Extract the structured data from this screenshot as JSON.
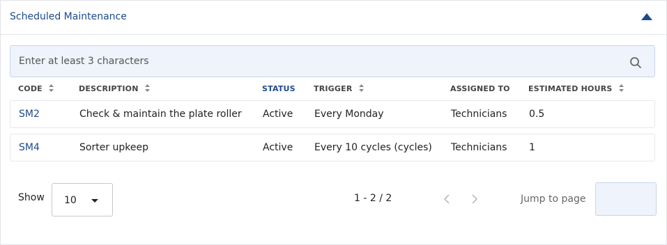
{
  "header": {
    "title": "Scheduled Maintenance"
  },
  "search": {
    "placeholder": "Enter at least 3 characters",
    "value": ""
  },
  "table": {
    "columns": {
      "code": "CODE",
      "description": "DESCRIPTION",
      "status": "STATUS",
      "trigger": "TRIGGER",
      "assigned_to": "ASSIGNED TO",
      "estimated_hours": "ESTIMATED HOURS"
    },
    "rows": [
      {
        "code": "SM2",
        "description": "Check & maintain the plate roller",
        "status": "Active",
        "trigger": "Every Monday",
        "assigned_to": "Technicians",
        "estimated_hours": "0.5"
      },
      {
        "code": "SM4",
        "description": "Sorter upkeep",
        "status": "Active",
        "trigger": "Every 10 cycles (cycles)",
        "assigned_to": "Technicians",
        "estimated_hours": "1"
      }
    ]
  },
  "pagination": {
    "show_label": "Show",
    "page_size": "10",
    "range": "1 - 2 / 2",
    "jump_label": "Jump to page",
    "jump_value": ""
  },
  "colors": {
    "accent": "#1e4a8c",
    "input_bg": "#eef3fc"
  },
  "icons": {
    "collapse": "triangle-up-icon",
    "search": "search-icon",
    "sort": "sort-icon",
    "prev": "chevron-left-icon",
    "next": "chevron-right-icon",
    "dropdown": "caret-down-icon"
  }
}
